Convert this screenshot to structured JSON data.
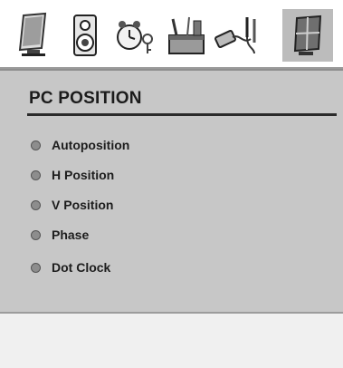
{
  "tabs": [
    {
      "id": "picture",
      "icon": "monitor-icon"
    },
    {
      "id": "sound",
      "icon": "speaker-icon"
    },
    {
      "id": "feature",
      "icon": "alarm-clock-icon"
    },
    {
      "id": "install",
      "icon": "toolbox-icon"
    },
    {
      "id": "source",
      "icon": "cable-connector-icon"
    },
    {
      "id": "pc",
      "icon": "pc-window-icon",
      "active": true
    }
  ],
  "panel": {
    "title": "PC POSITION",
    "items": [
      {
        "label": "Autoposition"
      },
      {
        "label": "H Position"
      },
      {
        "label": "V Position"
      },
      {
        "label": "Phase"
      },
      {
        "label": "Dot Clock"
      }
    ]
  },
  "colors": {
    "panel_bg": "#c7c7c7",
    "active_tab_bg": "#bcbcbc",
    "bullet": "#8d8d8d"
  }
}
